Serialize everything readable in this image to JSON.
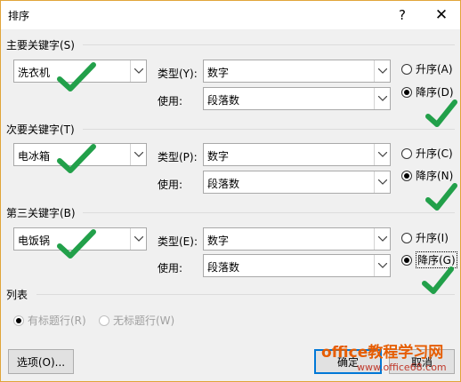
{
  "window": {
    "title": "排序"
  },
  "titlebar": {
    "help_glyph": "?",
    "close_glyph": "✕"
  },
  "sections": [
    {
      "label": "主要关键字(S)",
      "keyword": "洗衣机",
      "type_label": "类型(Y):",
      "type_value": "数字",
      "use_label": "使用:",
      "use_value": "段落数",
      "asc_label": "升序(A)",
      "desc_label": "降序(D)",
      "selected": "desc"
    },
    {
      "label": "次要关键字(T)",
      "keyword": "电冰箱",
      "type_label": "类型(P):",
      "type_value": "数字",
      "use_label": "使用:",
      "use_value": "段落数",
      "asc_label": "升序(C)",
      "desc_label": "降序(N)",
      "selected": "desc"
    },
    {
      "label": "第三关键字(B)",
      "keyword": "电饭锅",
      "type_label": "类型(E):",
      "type_value": "数字",
      "use_label": "使用:",
      "use_value": "段落数",
      "asc_label": "升序(I)",
      "desc_label": "降序(G)",
      "selected": "desc"
    }
  ],
  "list": {
    "label": "列表",
    "has_header_label": "有标题行(R)",
    "no_header_label": "无标题行(W)",
    "selected": "has_header"
  },
  "buttons": {
    "options_label": "选项(O)...",
    "ok_label": "确定",
    "cancel_label": "取消"
  },
  "watermark": {
    "main": "office教程学习网",
    "sub": "www.office68.com"
  },
  "colors": {
    "check_green": "#22a04a",
    "accent_border": "#e1a53a",
    "default_button": "#0078d7"
  }
}
